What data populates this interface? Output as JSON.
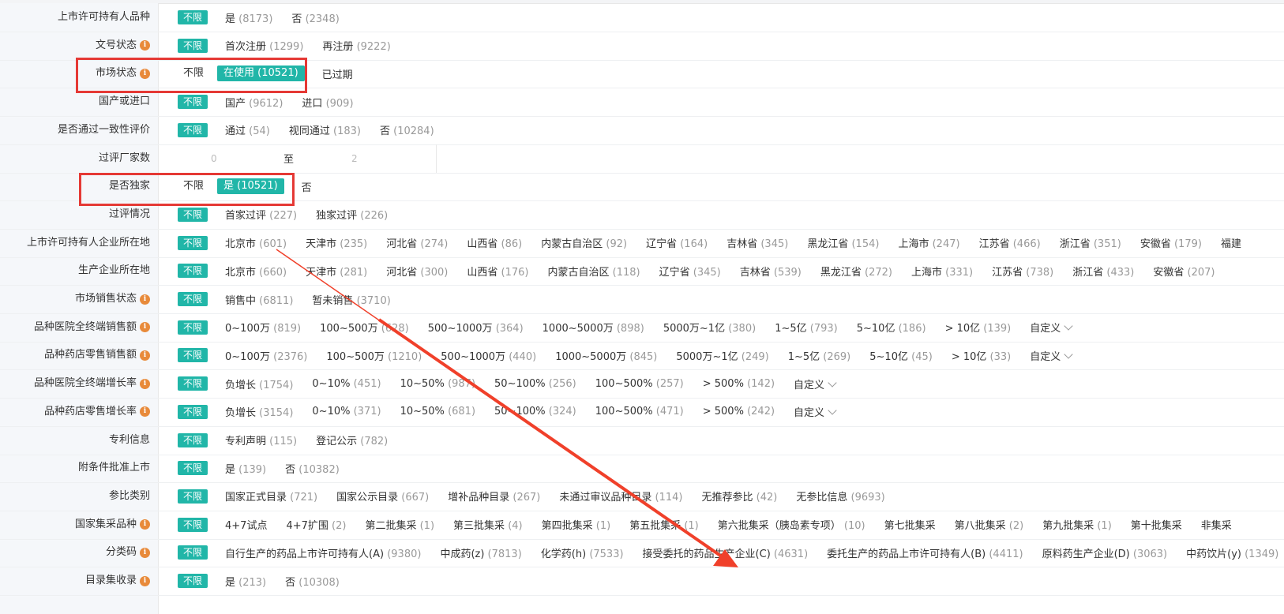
{
  "filters": [
    {
      "label": "上市许可持有人品种",
      "info": false,
      "all": "不限",
      "all_selected": true,
      "options": [
        {
          "t": "是",
          "c": "(8173)"
        },
        {
          "t": "否",
          "c": "(2348)"
        }
      ]
    },
    {
      "label": "文号状态",
      "info": true,
      "all": "不限",
      "all_selected": true,
      "options": [
        {
          "t": "首次注册",
          "c": "(1299)"
        },
        {
          "t": "再注册",
          "c": "(9222)"
        }
      ]
    },
    {
      "label": "市场状态",
      "info": true,
      "all": "不限",
      "all_selected": false,
      "options": [
        {
          "t": "在使用",
          "c": "(10521)",
          "sel": true
        },
        {
          "t": "已过期",
          "c": ""
        }
      ]
    },
    {
      "label": "国产或进口",
      "info": false,
      "all": "不限",
      "all_selected": true,
      "options": [
        {
          "t": "国产",
          "c": "(9612)"
        },
        {
          "t": "进口",
          "c": "(909)"
        }
      ]
    },
    {
      "label": "是否通过一致性评价",
      "info": false,
      "all": "不限",
      "all_selected": true,
      "options": [
        {
          "t": "通过",
          "c": "(54)"
        },
        {
          "t": "视同通过",
          "c": "(183)"
        },
        {
          "t": "否",
          "c": "(10284)"
        }
      ]
    },
    {
      "label": "过评厂家数",
      "info": false,
      "range": {
        "from": "0",
        "to_label": "至",
        "to": "2"
      }
    },
    {
      "label": "是否独家",
      "info": false,
      "all": "不限",
      "all_selected": false,
      "options": [
        {
          "t": "是",
          "c": "(10521)",
          "sel": true
        },
        {
          "t": "否",
          "c": ""
        }
      ]
    },
    {
      "label": "过评情况",
      "info": false,
      "all": "不限",
      "all_selected": true,
      "options": [
        {
          "t": "首家过评",
          "c": "(227)"
        },
        {
          "t": "独家过评",
          "c": "(226)"
        }
      ]
    },
    {
      "label": "上市许可持有人企业所在地",
      "info": false,
      "all": "不限",
      "all_selected": true,
      "options": [
        {
          "t": "北京市",
          "c": "(601)"
        },
        {
          "t": "天津市",
          "c": "(235)"
        },
        {
          "t": "河北省",
          "c": "(274)"
        },
        {
          "t": "山西省",
          "c": "(86)"
        },
        {
          "t": "内蒙古自治区",
          "c": "(92)"
        },
        {
          "t": "辽宁省",
          "c": "(164)"
        },
        {
          "t": "吉林省",
          "c": "(345)"
        },
        {
          "t": "黑龙江省",
          "c": "(154)"
        },
        {
          "t": "上海市",
          "c": "(247)"
        },
        {
          "t": "江苏省",
          "c": "(466)"
        },
        {
          "t": "浙江省",
          "c": "(351)"
        },
        {
          "t": "安徽省",
          "c": "(179)"
        },
        {
          "t": "福建",
          "c": ""
        }
      ]
    },
    {
      "label": "生产企业所在地",
      "info": false,
      "all": "不限",
      "all_selected": true,
      "options": [
        {
          "t": "北京市",
          "c": "(660)"
        },
        {
          "t": "天津市",
          "c": "(281)"
        },
        {
          "t": "河北省",
          "c": "(300)"
        },
        {
          "t": "山西省",
          "c": "(176)"
        },
        {
          "t": "内蒙古自治区",
          "c": "(118)"
        },
        {
          "t": "辽宁省",
          "c": "(345)"
        },
        {
          "t": "吉林省",
          "c": "(539)"
        },
        {
          "t": "黑龙江省",
          "c": "(272)"
        },
        {
          "t": "上海市",
          "c": "(331)"
        },
        {
          "t": "江苏省",
          "c": "(738)"
        },
        {
          "t": "浙江省",
          "c": "(433)"
        },
        {
          "t": "安徽省",
          "c": "(207)"
        }
      ]
    },
    {
      "label": "市场销售状态",
      "info": true,
      "all": "不限",
      "all_selected": true,
      "options": [
        {
          "t": "销售中",
          "c": "(6811)"
        },
        {
          "t": "暂未销售",
          "c": "(3710)"
        }
      ]
    },
    {
      "label": "品种医院全终端销售额",
      "info": true,
      "all": "不限",
      "all_selected": true,
      "options": [
        {
          "t": "0~100万",
          "c": "(819)"
        },
        {
          "t": "100~500万",
          "c": "(628)"
        },
        {
          "t": "500~1000万",
          "c": "(364)"
        },
        {
          "t": "1000~5000万",
          "c": "(898)"
        },
        {
          "t": "5000万~1亿",
          "c": "(380)"
        },
        {
          "t": "1~5亿",
          "c": "(793)"
        },
        {
          "t": "5~10亿",
          "c": "(186)"
        },
        {
          "t": "> 10亿",
          "c": "(139)"
        },
        {
          "t": "自定义",
          "c": "",
          "dd": true
        }
      ]
    },
    {
      "label": "品种药店零售销售额",
      "info": true,
      "all": "不限",
      "all_selected": true,
      "options": [
        {
          "t": "0~100万",
          "c": "(2376)"
        },
        {
          "t": "100~500万",
          "c": "(1210)"
        },
        {
          "t": "500~1000万",
          "c": "(440)"
        },
        {
          "t": "1000~5000万",
          "c": "(845)"
        },
        {
          "t": "5000万~1亿",
          "c": "(249)"
        },
        {
          "t": "1~5亿",
          "c": "(269)"
        },
        {
          "t": "5~10亿",
          "c": "(45)"
        },
        {
          "t": "> 10亿",
          "c": "(33)"
        },
        {
          "t": "自定义",
          "c": "",
          "dd": true
        }
      ]
    },
    {
      "label": "品种医院全终端增长率",
      "info": true,
      "all": "不限",
      "all_selected": true,
      "options": [
        {
          "t": "负增长",
          "c": "(1754)"
        },
        {
          "t": "0~10%",
          "c": "(451)"
        },
        {
          "t": "10~50%",
          "c": "(987)"
        },
        {
          "t": "50~100%",
          "c": "(256)"
        },
        {
          "t": "100~500%",
          "c": "(257)"
        },
        {
          "t": "> 500%",
          "c": "(142)"
        },
        {
          "t": "自定义",
          "c": "",
          "dd": true
        }
      ]
    },
    {
      "label": "品种药店零售增长率",
      "info": true,
      "all": "不限",
      "all_selected": true,
      "options": [
        {
          "t": "负增长",
          "c": "(3154)"
        },
        {
          "t": "0~10%",
          "c": "(371)"
        },
        {
          "t": "10~50%",
          "c": "(681)"
        },
        {
          "t": "50~100%",
          "c": "(324)"
        },
        {
          "t": "100~500%",
          "c": "(471)"
        },
        {
          "t": "> 500%",
          "c": "(242)"
        },
        {
          "t": "自定义",
          "c": "",
          "dd": true
        }
      ]
    },
    {
      "label": "专利信息",
      "info": false,
      "all": "不限",
      "all_selected": true,
      "options": [
        {
          "t": "专利声明",
          "c": "(115)"
        },
        {
          "t": "登记公示",
          "c": "(782)"
        }
      ]
    },
    {
      "label": "附条件批准上市",
      "info": false,
      "all": "不限",
      "all_selected": true,
      "options": [
        {
          "t": "是",
          "c": "(139)"
        },
        {
          "t": "否",
          "c": "(10382)"
        }
      ]
    },
    {
      "label": "参比类别",
      "info": false,
      "all": "不限",
      "all_selected": true,
      "options": [
        {
          "t": "国家正式目录",
          "c": "(721)"
        },
        {
          "t": "国家公示目录",
          "c": "(667)"
        },
        {
          "t": "增补品种目录",
          "c": "(267)"
        },
        {
          "t": "未通过审议品种目录",
          "c": "(114)"
        },
        {
          "t": "无推荐参比",
          "c": "(42)"
        },
        {
          "t": "无参比信息",
          "c": "(9693)"
        }
      ]
    },
    {
      "label": "国家集采品种",
      "info": true,
      "all": "不限",
      "all_selected": true,
      "options": [
        {
          "t": "4+7试点",
          "c": ""
        },
        {
          "t": "4+7扩围",
          "c": "(2)"
        },
        {
          "t": "第二批集采",
          "c": "(1)"
        },
        {
          "t": "第三批集采",
          "c": "(4)"
        },
        {
          "t": "第四批集采",
          "c": "(1)"
        },
        {
          "t": "第五批集采",
          "c": "(1)"
        },
        {
          "t": "第六批集采（胰岛素专项）",
          "c": "(10)"
        },
        {
          "t": "第七批集采",
          "c": ""
        },
        {
          "t": "第八批集采",
          "c": "(2)"
        },
        {
          "t": "第九批集采",
          "c": "(1)"
        },
        {
          "t": "第十批集采",
          "c": ""
        },
        {
          "t": "非集采",
          "c": ""
        }
      ]
    },
    {
      "label": "分类码",
      "info": true,
      "all": "不限",
      "all_selected": true,
      "options": [
        {
          "t": "自行生产的药品上市许可持有人(A)",
          "c": "(9380)"
        },
        {
          "t": "中成药(z)",
          "c": "(7813)"
        },
        {
          "t": "化学药(h)",
          "c": "(7533)"
        },
        {
          "t": "接受委托的药品生产企业(C)",
          "c": "(4631)"
        },
        {
          "t": "委托生产的药品上市许可持有人(B)",
          "c": "(4411)"
        },
        {
          "t": "原料药生产企业(D)",
          "c": "(3063)"
        },
        {
          "t": "中药饮片(y)",
          "c": "(1349)"
        }
      ]
    },
    {
      "label": "目录集收录",
      "info": true,
      "all": "不限",
      "all_selected": true,
      "options": [
        {
          "t": "是",
          "c": "(213)"
        },
        {
          "t": "否",
          "c": "(10308)"
        }
      ]
    }
  ],
  "colors": {
    "accent": "#21b6a8",
    "highlight": "#e53935",
    "info_icon": "#e88a3a"
  },
  "icons": {
    "info": "info-icon",
    "dropdown": "chevron-down-icon"
  }
}
